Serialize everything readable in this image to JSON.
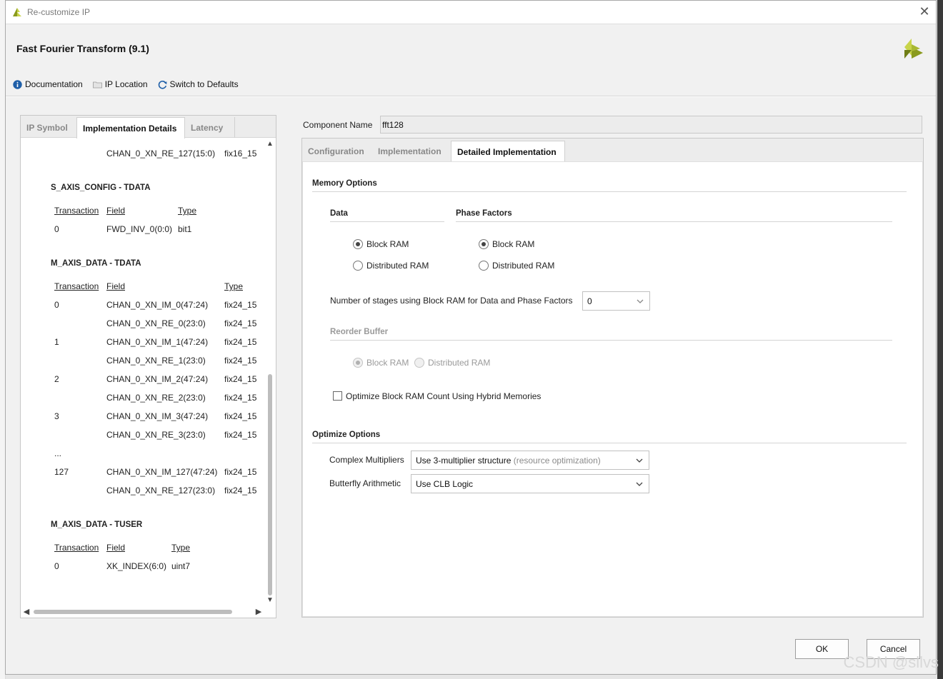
{
  "window": {
    "title": "Re-customize IP",
    "close_glyph": "✕"
  },
  "header": {
    "heading": "Fast Fourier Transform (9.1)"
  },
  "toolbar": {
    "documentation": "Documentation",
    "ip_location": "IP Location",
    "switch_defaults": "Switch to Defaults"
  },
  "left_tabs": [
    "IP Symbol",
    "Implementation Details",
    "Latency"
  ],
  "impl_details": {
    "top_row": {
      "field": "CHAN_0_XN_RE_127(15:0)",
      "type": "fix16_15"
    },
    "s_axis_config": {
      "title": "S_AXIS_CONFIG - TDATA",
      "headers": [
        "Transaction",
        "Field",
        "Type"
      ],
      "rows": [
        {
          "transaction": "0",
          "field": "FWD_INV_0(0:0)",
          "type": "bit1"
        }
      ]
    },
    "m_axis_data": {
      "title": "M_AXIS_DATA - TDATA",
      "headers": [
        "Transaction",
        "Field",
        "Type"
      ],
      "rows": [
        {
          "transaction": "0",
          "field": "CHAN_0_XN_IM_0(47:24)",
          "type": "fix24_15"
        },
        {
          "transaction": "",
          "field": "CHAN_0_XN_RE_0(23:0)",
          "type": "fix24_15"
        },
        {
          "transaction": "1",
          "field": "CHAN_0_XN_IM_1(47:24)",
          "type": "fix24_15"
        },
        {
          "transaction": "",
          "field": "CHAN_0_XN_RE_1(23:0)",
          "type": "fix24_15"
        },
        {
          "transaction": "2",
          "field": "CHAN_0_XN_IM_2(47:24)",
          "type": "fix24_15"
        },
        {
          "transaction": "",
          "field": "CHAN_0_XN_RE_2(23:0)",
          "type": "fix24_15"
        },
        {
          "transaction": "3",
          "field": "CHAN_0_XN_IM_3(47:24)",
          "type": "fix24_15"
        },
        {
          "transaction": "",
          "field": "CHAN_0_XN_RE_3(23:0)",
          "type": "fix24_15"
        },
        {
          "transaction": "...",
          "field": "",
          "type": ""
        },
        {
          "transaction": "127",
          "field": "CHAN_0_XN_IM_127(47:24)",
          "type": "fix24_15"
        },
        {
          "transaction": "",
          "field": "CHAN_0_XN_RE_127(23:0)",
          "type": "fix24_15"
        }
      ]
    },
    "m_axis_tuser": {
      "title": "M_AXIS_DATA - TUSER",
      "headers": [
        "Transaction",
        "Field",
        "Type"
      ],
      "rows": [
        {
          "transaction": "0",
          "field": "XK_INDEX(6:0)",
          "type": "uint7"
        }
      ]
    }
  },
  "component": {
    "label": "Component Name",
    "value": "fft128"
  },
  "right_tabs": [
    "Configuration",
    "Implementation",
    "Detailed Implementation"
  ],
  "memory": {
    "title": "Memory Options",
    "data_title": "Data",
    "phase_title": "Phase Factors",
    "block_ram": "Block RAM",
    "distributed_ram": "Distributed RAM",
    "stages_label": "Number of stages using Block RAM for Data and Phase Factors",
    "stages_value": "0",
    "reorder_title": "Reorder Buffer",
    "hybrid_label": "Optimize Block RAM Count Using Hybrid Memories",
    "data_selected": "Block RAM",
    "phase_selected": "Block RAM",
    "reorder_selected": "Block RAM",
    "hybrid_checked": false
  },
  "optimize": {
    "title": "Optimize Options",
    "complex_label": "Complex Multipliers",
    "complex_value": "Use 3-multiplier structure",
    "complex_hint": "(resource optimization)",
    "butterfly_label": "Butterfly Arithmetic",
    "butterfly_value": "Use CLB Logic"
  },
  "buttons": {
    "ok": "OK",
    "cancel": "Cancel"
  },
  "watermark": "CSDN @sllvs",
  "colors": {
    "brand_light": "#c8d44a",
    "brand_dark": "#8a9a1e",
    "info_icon": "#1f5fa8"
  }
}
